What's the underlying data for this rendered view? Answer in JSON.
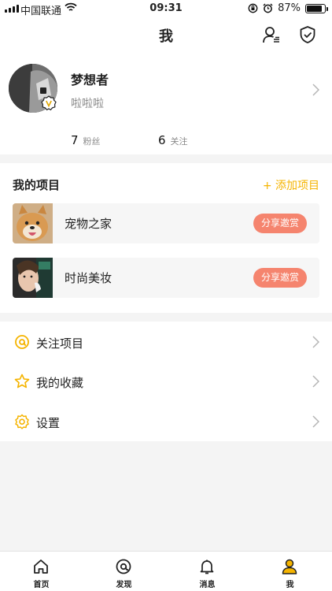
{
  "status_bar": {
    "carrier": "中国联通",
    "time": "09:31",
    "battery_percent": "87%",
    "battery_level": 0.87
  },
  "nav": {
    "title": "我"
  },
  "profile": {
    "name": "梦想者",
    "bio": "啦啦啦",
    "followers_count": "7",
    "followers_label": "粉丝",
    "following_count": "6",
    "following_label": "关注"
  },
  "projects": {
    "heading": "我的项目",
    "add_label": "+ 添加项目",
    "items": [
      {
        "name": "宠物之家",
        "action": "分享邀赏"
      },
      {
        "name": "时尚美妆",
        "action": "分享邀赏"
      }
    ]
  },
  "menu": {
    "items": [
      {
        "label": "关注项目",
        "icon": "at-circle-icon"
      },
      {
        "label": "我的收藏",
        "icon": "star-icon"
      },
      {
        "label": "设置",
        "icon": "gear-icon"
      }
    ]
  },
  "tabbar": {
    "items": [
      {
        "label": "首页",
        "icon": "home-icon"
      },
      {
        "label": "发现",
        "icon": "discover-icon"
      },
      {
        "label": "消息",
        "icon": "bell-icon"
      },
      {
        "label": "我",
        "icon": "user-icon",
        "active": true
      }
    ]
  },
  "colors": {
    "accent": "#f5b400",
    "share_button": "#f5846e",
    "background": "#f4f4f4"
  }
}
